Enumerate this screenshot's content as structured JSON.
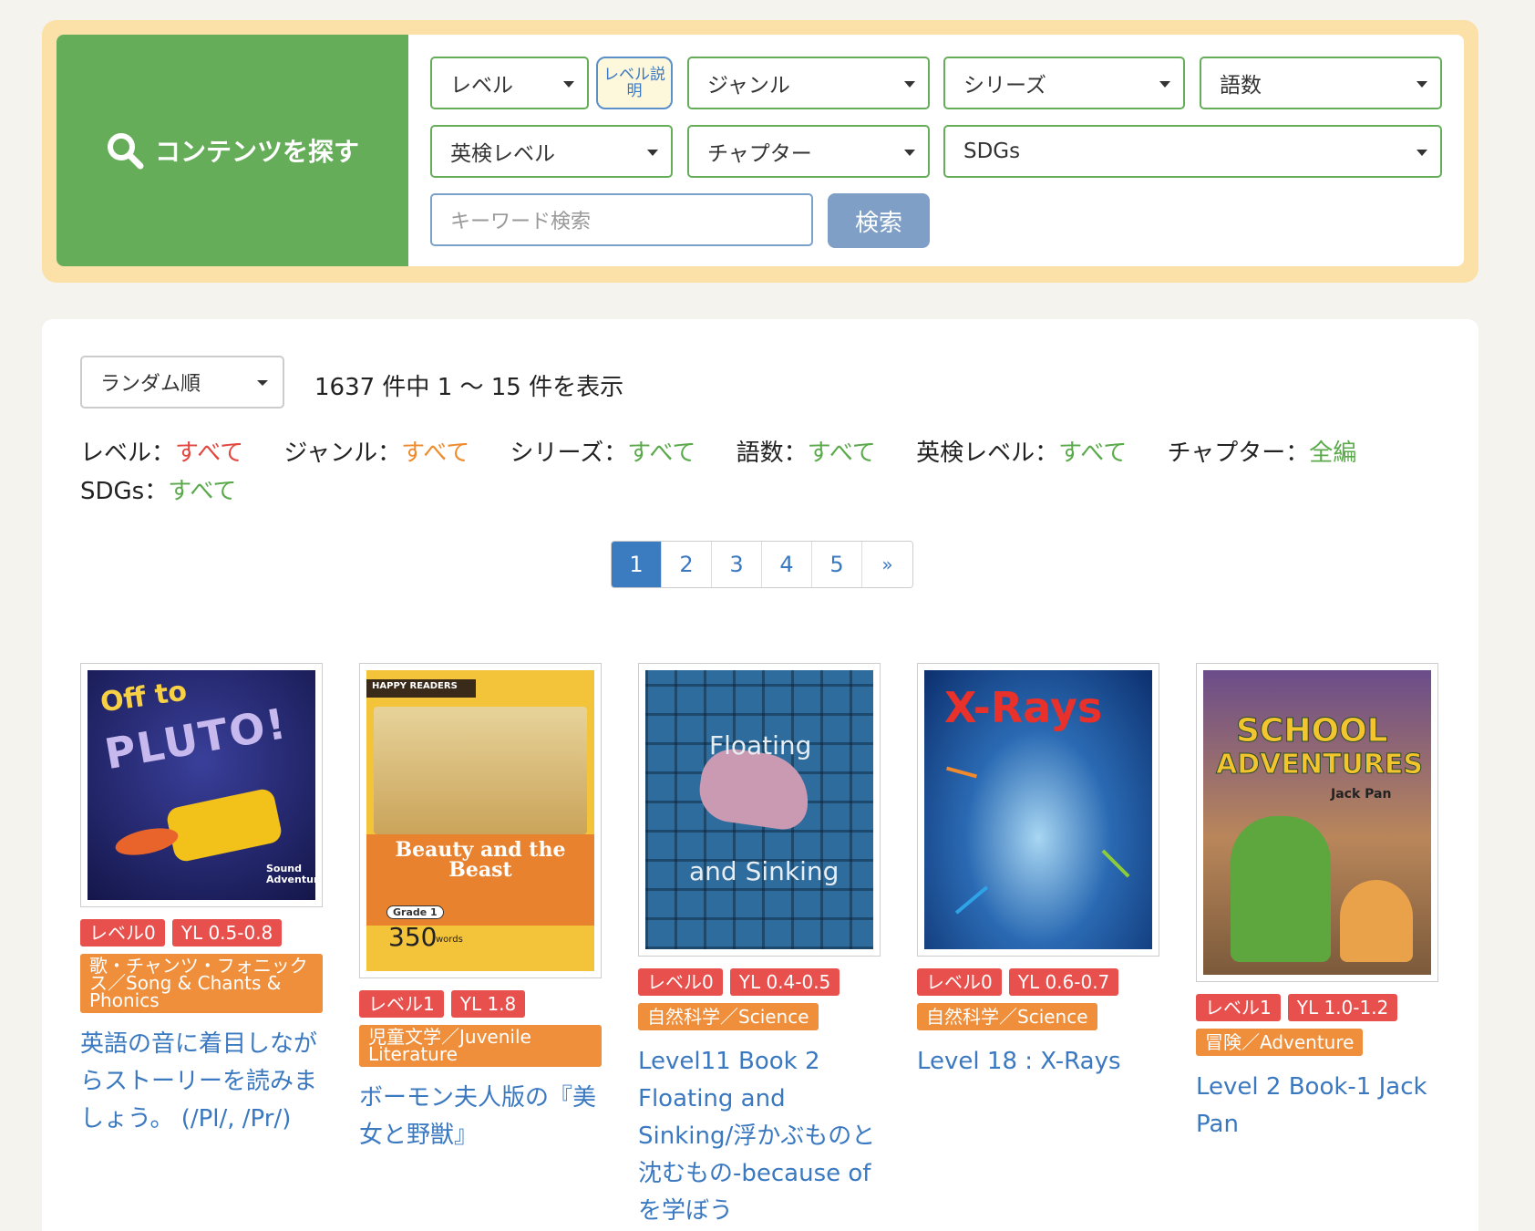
{
  "search": {
    "title": "コンテンツを探す",
    "level": "レベル",
    "level_help": "レベル説明",
    "genre": "ジャンル",
    "series": "シリーズ",
    "words": "語数",
    "eiken": "英検レベル",
    "chapter": "チャプター",
    "sdgs": "SDGs",
    "keyword_placeholder": "キーワード検索",
    "search_button": "検索"
  },
  "results": {
    "sort": "ランダム順",
    "count_text": "1637 件中 1 〜 15 件を表示",
    "filters": [
      {
        "label": "レベル：",
        "value": "すべて",
        "color": "#e2473f"
      },
      {
        "label": "ジャンル：",
        "value": "すべて",
        "color": "#ef8b2c"
      },
      {
        "label": "シリーズ：",
        "value": "すべて",
        "color": "#5aaa4b"
      },
      {
        "label": "語数：",
        "value": "すべて",
        "color": "#5aaa4b"
      },
      {
        "label": "英検レベル：",
        "value": "すべて",
        "color": "#5aaa4b"
      },
      {
        "label": "チャプター：",
        "value": "全編",
        "color": "#5aaa4b"
      },
      {
        "label": "SDGs：",
        "value": "すべて",
        "color": "#5aaa4b"
      }
    ],
    "pagination": [
      "1",
      "2",
      "3",
      "4",
      "5",
      "»"
    ],
    "current_page": "1"
  },
  "books": [
    {
      "level": "レベル0",
      "yl": "YL 0.5-0.8",
      "genre": "歌・チャンツ・フォニックス／Song & Chants & Phonics",
      "title": "英語の音に着目しながらストーリーを読みましょう。 (/Pl/, /Pr/)",
      "cover_text": [
        "Off to",
        "PLUTO!",
        "Sound Adventures"
      ]
    },
    {
      "level": "レベル1",
      "yl": "YL 1.8",
      "genre": "児童文学／Juvenile Literature",
      "title": "ボーモン夫人版の『美女と野獣』",
      "cover_text": [
        "HAPPY READERS",
        "Beauty and the Beast",
        "Grade 1",
        "350",
        "words"
      ]
    },
    {
      "level": "レベル0",
      "yl": "YL 0.4-0.5",
      "genre": "自然科学／Science",
      "title": "Level11 Book 2 Floating and Sinking/浮かぶものと沈むもの-because ofを学ぼう",
      "cover_text": [
        "Floating",
        "and Sinking"
      ]
    },
    {
      "level": "レベル0",
      "yl": "YL 0.6-0.7",
      "genre": "自然科学／Science",
      "title": "Level 18 : X-Rays",
      "cover_text": [
        "X-Rays"
      ]
    },
    {
      "level": "レベル1",
      "yl": "YL 1.0-1.2",
      "genre": "冒険／Adventure",
      "title": "Level 2 Book-1 Jack Pan",
      "cover_text": [
        "SCHOOL",
        "ADVENTURES",
        "Jack Pan"
      ]
    }
  ]
}
